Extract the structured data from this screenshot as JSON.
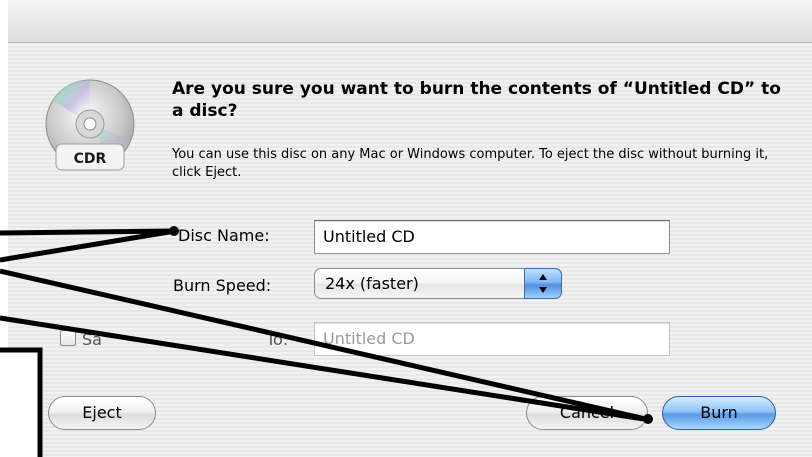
{
  "dialog": {
    "headline": "Are you sure you want to burn the contents of “Untitled CD” to a disc?",
    "message": "You can use this disc on any Mac or Windows computer. To eject the disc without burning it, click Eject.",
    "icon": {
      "name": "cdr-disc-icon",
      "text": "CDR"
    }
  },
  "fields": {
    "disc_name_label": "Disc Name:",
    "disc_name_value": "Untitled CD",
    "burn_speed_label": "Burn Speed:",
    "burn_speed_value": "24x (faster)",
    "save_burn_partial_label": "Sa",
    "save_burn_partial_label_end": "To:",
    "save_burn_folder_value": "Untitled CD"
  },
  "buttons": {
    "eject": "Eject",
    "cancel_partial": "Cancel",
    "burn": "Burn"
  },
  "colors": {
    "default_button": "#5a9be6",
    "annotation_stroke": "#000000"
  }
}
